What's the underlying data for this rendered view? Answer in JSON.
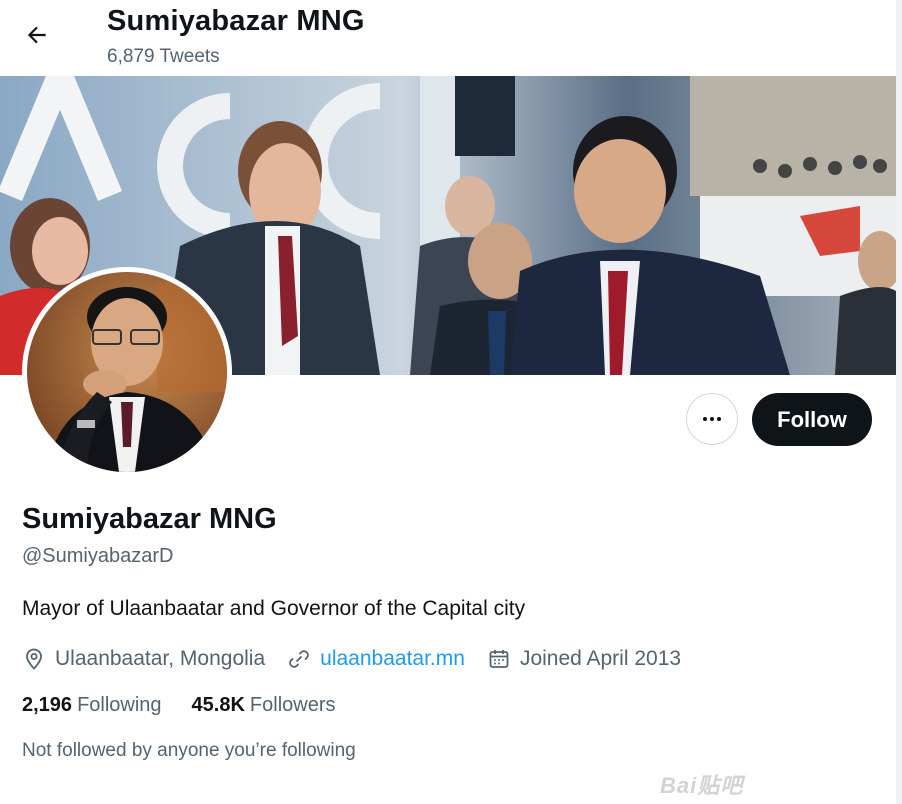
{
  "header": {
    "display_name": "Sumiyabazar MNG",
    "tweet_count": "6,879 Tweets"
  },
  "actions": {
    "follow_label": "Follow"
  },
  "profile": {
    "display_name": "Sumiyabazar MNG",
    "handle": "@SumiyabazarD",
    "bio": "Mayor of Ulaanbaatar and Governor of the Capital city",
    "location": "Ulaanbaatar, Mongolia",
    "website": "ulaanbaatar.mn",
    "joined": "Joined April 2013"
  },
  "stats": {
    "following_count": "2,196",
    "following_label": "Following",
    "followers_count": "45.8K",
    "followers_label": "Followers"
  },
  "social_context": "Not followed by anyone you’re following",
  "watermark": "Bai贴吧",
  "colors": {
    "text_primary": "#0f1419",
    "text_secondary": "#536471",
    "link": "#1d9bf0",
    "follow_bg": "#0f1419"
  }
}
